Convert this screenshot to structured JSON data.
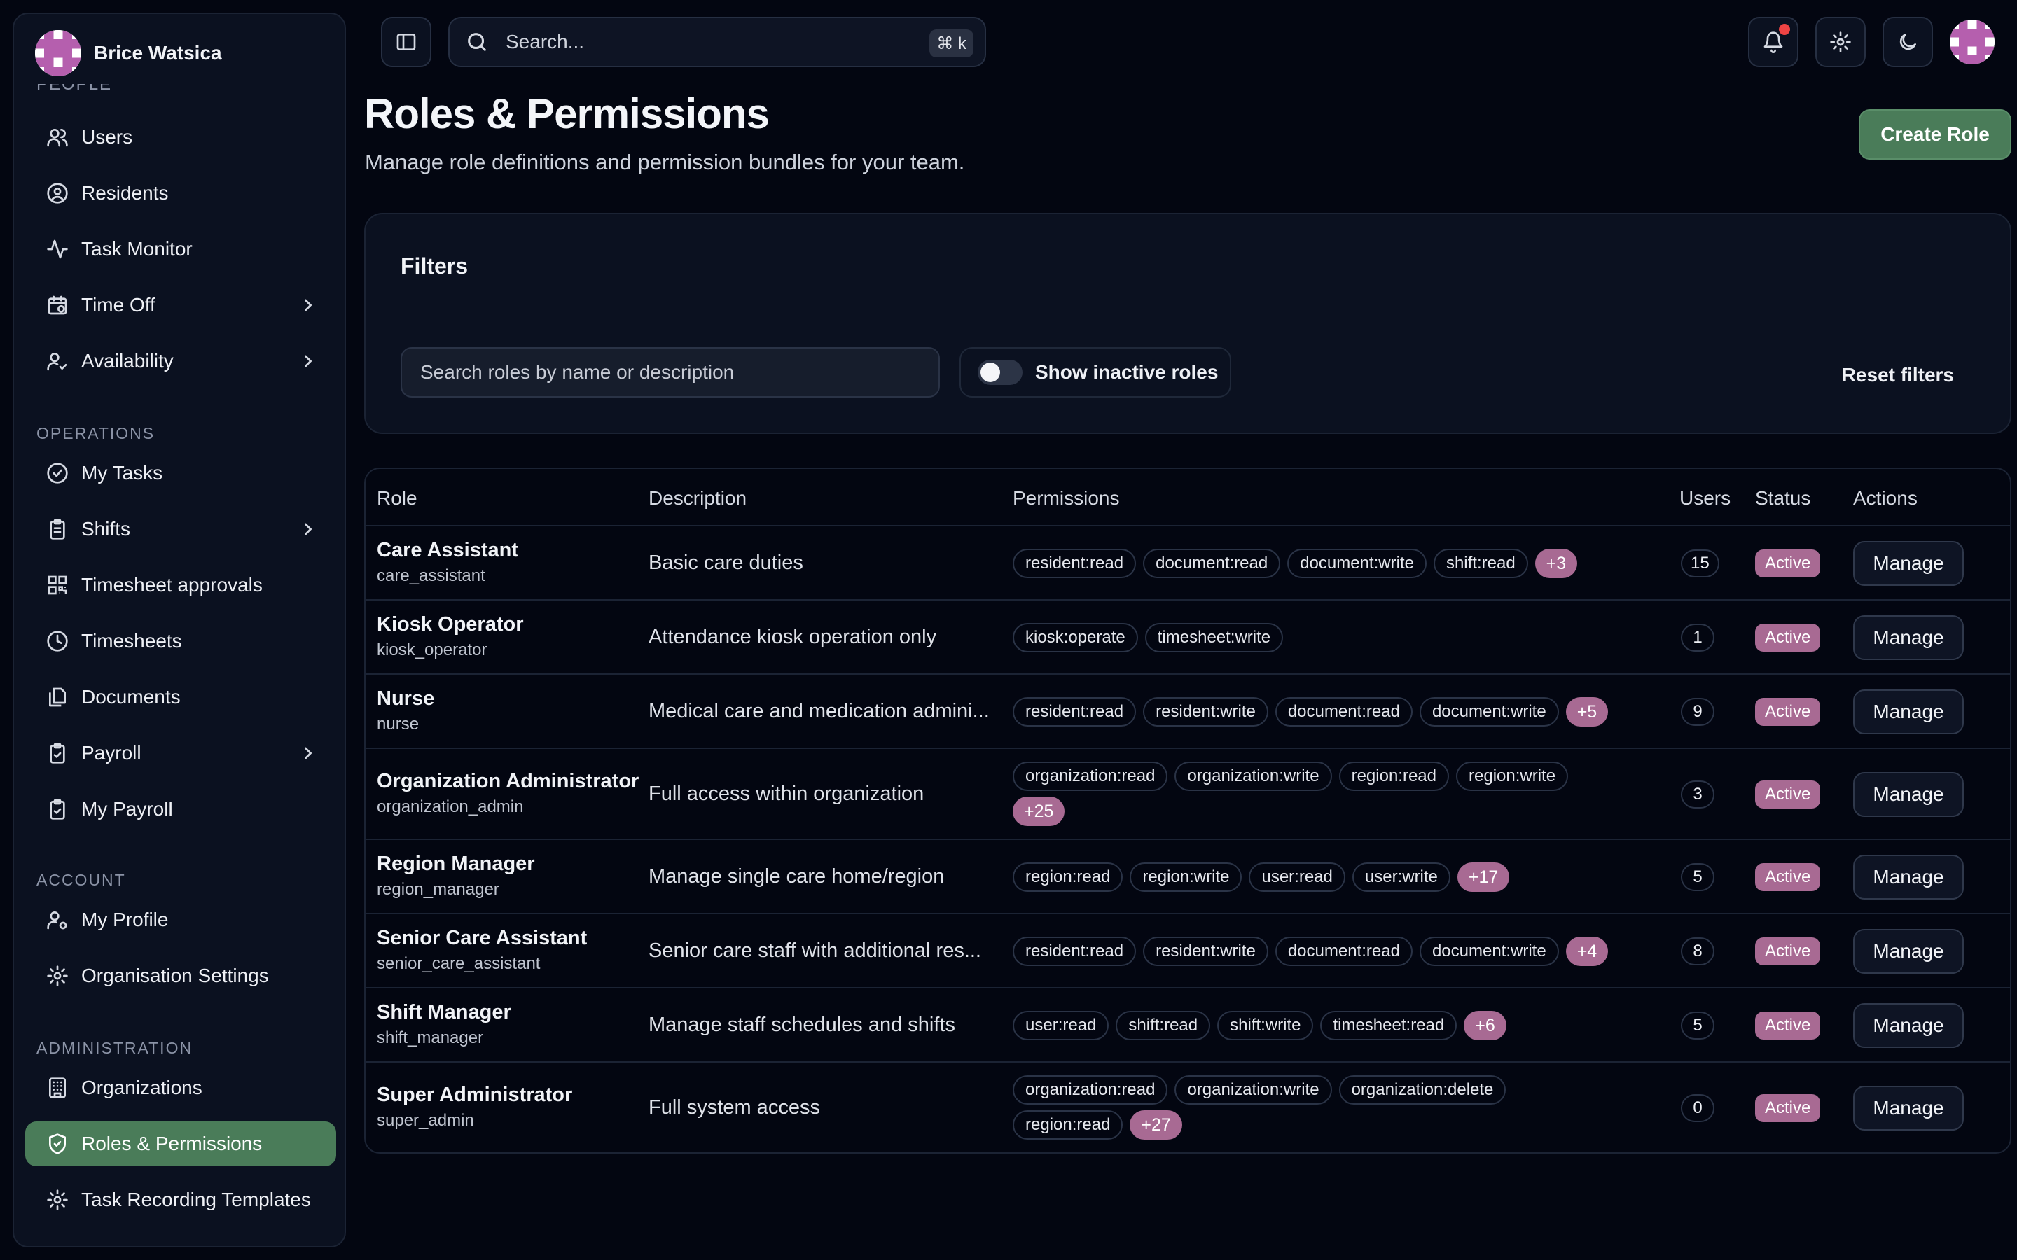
{
  "user": {
    "name": "Brice Watsica"
  },
  "sidebar": {
    "clipped_heading": "PEOPLE",
    "people_items": [
      {
        "label": "Users",
        "icon": "users-icon"
      },
      {
        "label": "Residents",
        "icon": "user-circle-icon"
      },
      {
        "label": "Task Monitor",
        "icon": "activity-icon"
      },
      {
        "label": "Time Off",
        "icon": "calendar-clock-icon"
      },
      {
        "label": "Availability",
        "icon": "user-check-icon"
      }
    ],
    "operations_heading": "OPERATIONS",
    "operations_items": [
      {
        "label": "My Tasks",
        "icon": "check-circle-icon"
      },
      {
        "label": "Shifts",
        "icon": "clipboard-icon"
      },
      {
        "label": "Timesheet approvals",
        "icon": "qr-code-icon"
      },
      {
        "label": "Timesheets",
        "icon": "clock-icon"
      },
      {
        "label": "Documents",
        "icon": "documents-icon"
      },
      {
        "label": "Payroll",
        "icon": "clipboard-check-icon"
      },
      {
        "label": "My Payroll",
        "icon": "clipboard-check-icon"
      }
    ],
    "account_heading": "ACCOUNT",
    "account_items": [
      {
        "label": "My Profile",
        "icon": "user-cog-icon"
      },
      {
        "label": "Organisation Settings",
        "icon": "gear-icon"
      }
    ],
    "administration_heading": "ADMINISTRATION",
    "administration_items": [
      {
        "label": "Organizations",
        "icon": "building-icon"
      },
      {
        "label": "Roles & Permissions",
        "icon": "shield-check-icon",
        "active": true
      },
      {
        "label": "Task Recording Templates",
        "icon": "gear-icon"
      }
    ]
  },
  "topbar": {
    "search_placeholder": "Search...",
    "shortcut": "⌘ k"
  },
  "page": {
    "title": "Roles & Permissions",
    "subtitle": "Manage role definitions and permission bundles for your team.",
    "create_button": "Create Role"
  },
  "filters": {
    "title": "Filters",
    "search_placeholder": "Search roles by name or description",
    "toggle_label": "Show inactive roles",
    "toggle_on": false,
    "reset_label": "Reset filters"
  },
  "table": {
    "columns": [
      "Role",
      "Description",
      "Permissions",
      "Users",
      "Status",
      "Actions"
    ],
    "action_label": "Manage",
    "rows": [
      {
        "name": "Care Assistant",
        "key": "care_assistant",
        "description": "Basic care duties",
        "permissions": [
          "resident:read",
          "document:read",
          "document:write",
          "shift:read"
        ],
        "more": "+3",
        "users": "15",
        "status": "Active"
      },
      {
        "name": "Kiosk Operator",
        "key": "kiosk_operator",
        "description": "Attendance kiosk operation only",
        "permissions": [
          "kiosk:operate",
          "timesheet:write"
        ],
        "more": "",
        "users": "1",
        "status": "Active"
      },
      {
        "name": "Nurse",
        "key": "nurse",
        "description": "Medical care and medication admini...",
        "permissions": [
          "resident:read",
          "resident:write",
          "document:read",
          "document:write"
        ],
        "more": "+5",
        "users": "9",
        "status": "Active"
      },
      {
        "name": "Organization Administrator",
        "key": "organization_admin",
        "description": "Full access within organization",
        "permissions": [
          "organization:read",
          "organization:write",
          "region:read",
          "region:write"
        ],
        "more": "+25",
        "users": "3",
        "status": "Active"
      },
      {
        "name": "Region Manager",
        "key": "region_manager",
        "description": "Manage single care home/region",
        "permissions": [
          "region:read",
          "region:write",
          "user:read",
          "user:write"
        ],
        "more": "+17",
        "users": "5",
        "status": "Active"
      },
      {
        "name": "Senior Care Assistant",
        "key": "senior_care_assistant",
        "description": "Senior care staff with additional res...",
        "permissions": [
          "resident:read",
          "resident:write",
          "document:read",
          "document:write"
        ],
        "more": "+4",
        "users": "8",
        "status": "Active"
      },
      {
        "name": "Shift Manager",
        "key": "shift_manager",
        "description": "Manage staff schedules and shifts",
        "permissions": [
          "user:read",
          "shift:read",
          "shift:write",
          "timesheet:read"
        ],
        "more": "+6",
        "users": "5",
        "status": "Active"
      },
      {
        "name": "Super Administrator",
        "key": "super_admin",
        "description": "Full system access",
        "permissions": [
          "organization:read",
          "organization:write",
          "organization:delete",
          "region:read"
        ],
        "more": "+27",
        "users": "0",
        "status": "Active"
      }
    ]
  },
  "colors": {
    "accent_green": "#4a7c59",
    "badge_pink": "#a86a93",
    "background": "#030611"
  }
}
